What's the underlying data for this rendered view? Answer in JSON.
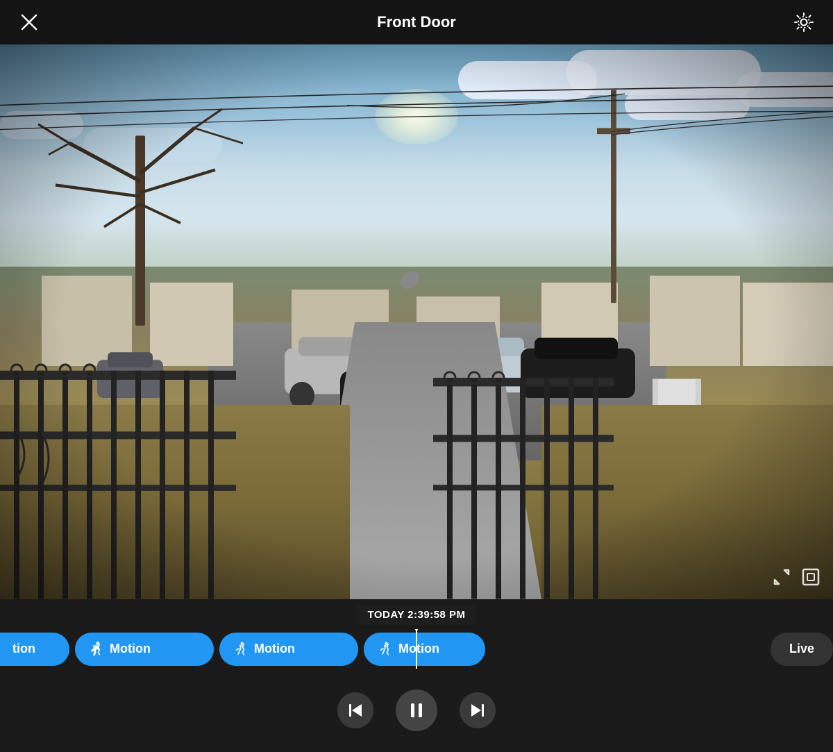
{
  "header": {
    "title": "Front Door",
    "close_label": "Close",
    "settings_label": "Settings"
  },
  "video": {
    "timestamp": "TODAY 2:39:58 PM"
  },
  "timeline": {
    "events": [
      {
        "id": "motion-partial",
        "label": "tion",
        "type": "motion",
        "partial": true
      },
      {
        "id": "motion-1",
        "label": "Motion",
        "type": "motion",
        "partial": false
      },
      {
        "id": "motion-2",
        "label": "Motion",
        "type": "motion",
        "partial": false
      },
      {
        "id": "motion-3",
        "label": "Motion",
        "type": "motion",
        "partial": false
      }
    ],
    "live_label": "Live"
  },
  "controls": {
    "prev_label": "Previous",
    "pause_label": "Pause",
    "next_label": "Next"
  },
  "corner_icons": {
    "expand_label": "Expand",
    "fullscreen_label": "Fullscreen"
  }
}
